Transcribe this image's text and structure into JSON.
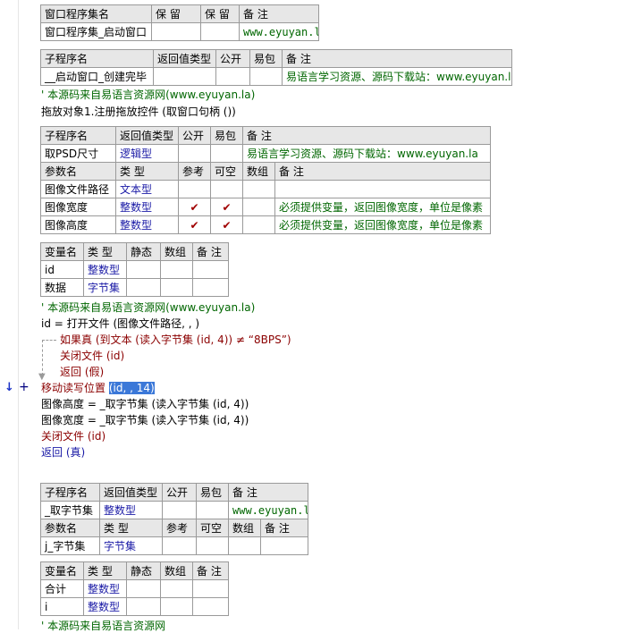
{
  "colors": {
    "blue": "#1a1aa6",
    "green": "#006600",
    "flow_red": "#8b0000",
    "header_bg": "#e7e7e7"
  },
  "markers": {
    "arrow": "↓",
    "plus": "+"
  },
  "program_set": {
    "headers": [
      "窗口程序集名",
      "保 留",
      "保 留",
      "备 注"
    ],
    "row": [
      "窗口程序集_启动窗口",
      "",
      "",
      "www.eyuyan.la"
    ]
  },
  "sub1": {
    "headers": [
      "子程序名",
      "返回值类型",
      "公开",
      "易包",
      "备 注"
    ],
    "row": [
      "__启动窗口_创建完毕",
      "",
      "",
      "",
      "易语言学习资源、源码下载站：www.eyuyan.la"
    ]
  },
  "comment1": "' 本源码来自易语言资源网(www.eyuyan.la)",
  "code1": "拖放对象1.注册拖放控件 (取窗口句柄 ())",
  "sub2": {
    "headers": [
      "子程序名",
      "返回值类型",
      "公开",
      "易包",
      "备 注"
    ],
    "row": [
      "取PSD尺寸",
      "逻辑型",
      "",
      "",
      "易语言学习资源、源码下载站：www.eyuyan.la"
    ],
    "param_headers": [
      "参数名",
      "类 型",
      "参考",
      "可空",
      "数组",
      "备 注"
    ],
    "params": [
      {
        "name": "图像文件路径",
        "type": "文本型",
        "ref": "",
        "opt": "",
        "arr": "",
        "note": ""
      },
      {
        "name": "图像宽度",
        "type": "整数型",
        "ref": "✔",
        "opt": "✔",
        "arr": "",
        "note": "必须提供变量，返回图像宽度，单位是像素"
      },
      {
        "name": "图像高度",
        "type": "整数型",
        "ref": "✔",
        "opt": "✔",
        "arr": "",
        "note": "必须提供变量，返回图像宽度，单位是像素"
      }
    ]
  },
  "vars2": {
    "headers": [
      "变量名",
      "类 型",
      "静态",
      "数组",
      "备 注"
    ],
    "rows": [
      {
        "name": "id",
        "type": "整数型"
      },
      {
        "name": "数据",
        "type": "字节集"
      }
    ]
  },
  "code2": {
    "comment": "' 本源码来自易语言资源网(www.eyuyan.la)",
    "open": "id = 打开文件 (图像文件路径, , )",
    "if": "如果真 (到文本 (读入字节集 (id, 4)) ≠ “8BPS”)",
    "close1": "关闭文件 (id)",
    "ret1": "返回 (假)",
    "seek_pre": "移动读写位置 ",
    "seek_sel": "(id, , 14)",
    "height": "图像高度 = _取字节集 (读入字节集 (id, 4))",
    "width": "图像宽度 = _取字节集 (读入字节集 (id, 4))",
    "close2": "关闭文件 (id)",
    "ret2": "返回 (真)"
  },
  "sub3": {
    "headers": [
      "子程序名",
      "返回值类型",
      "公开",
      "易包",
      "备 注"
    ],
    "row": [
      "_取字节集",
      "整数型",
      "",
      "",
      "www.eyuyan.la"
    ],
    "param_headers": [
      "参数名",
      "类 型",
      "参考",
      "可空",
      "数组",
      "备 注"
    ],
    "param": {
      "name": "j_字节集",
      "type": "字节集"
    }
  },
  "vars3": {
    "headers": [
      "变量名",
      "类 型",
      "静态",
      "数组",
      "备 注"
    ],
    "rows": [
      {
        "name": "合计",
        "type": "整数型"
      },
      {
        "name": "i",
        "type": "整数型"
      }
    ]
  },
  "comment_last": "' 本源码来自易语言资源网"
}
